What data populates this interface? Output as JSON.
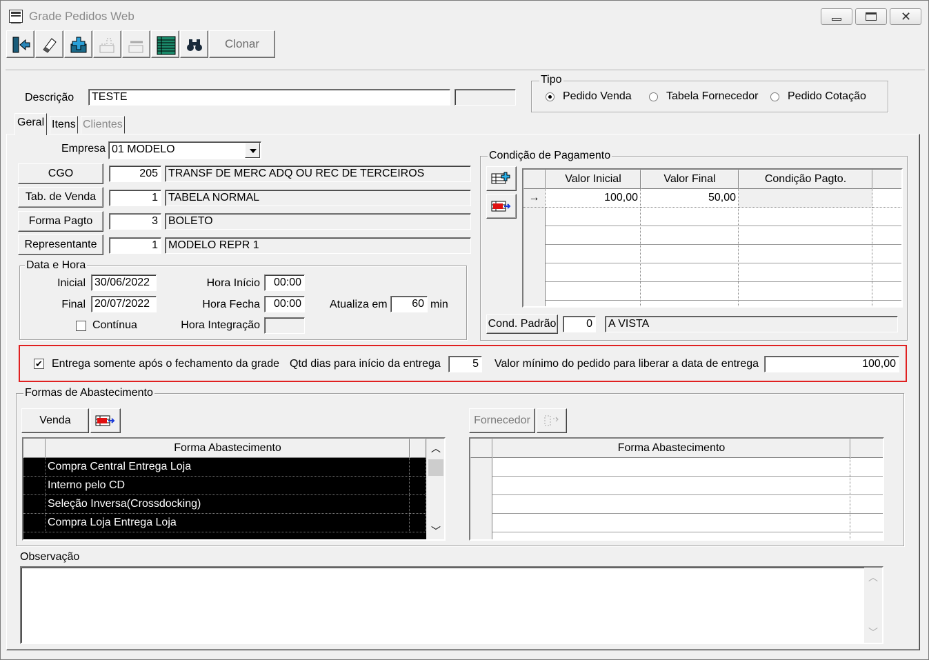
{
  "window": {
    "title": "Grade Pedidos Web",
    "controls": [
      "minimize-icon",
      "maximize-icon",
      "close-icon"
    ]
  },
  "toolbar": {
    "icons": [
      "exit-icon",
      "eraser-icon",
      "add-record-icon",
      "copy-disabled-icon",
      "remove-disabled-icon",
      "grid-sheet-icon",
      "binoculars-icon"
    ],
    "clonar_label": "Clonar"
  },
  "header": {
    "descricao_label": "Descrição",
    "descricao_value": "TESTE",
    "extra_value": ""
  },
  "tipo": {
    "title": "Tipo",
    "options": [
      {
        "label": "Pedido Venda",
        "selected": true
      },
      {
        "label": "Tabela Fornecedor",
        "selected": false
      },
      {
        "label": "Pedido Cotação",
        "selected": false
      }
    ]
  },
  "tabs": [
    {
      "label": "Geral",
      "active": true,
      "enabled": true
    },
    {
      "label": "Itens",
      "active": false,
      "enabled": true
    },
    {
      "label": "Clientes",
      "active": false,
      "enabled": false
    }
  ],
  "geral": {
    "empresa_label": "Empresa",
    "empresa_value": "01 MODELO",
    "cgo": {
      "button": "CGO",
      "code": "205",
      "desc": "TRANSF DE MERC ADQ OU REC DE TERCEIROS"
    },
    "tab_venda": {
      "button": "Tab. de Venda",
      "code": "1",
      "desc": "TABELA NORMAL"
    },
    "forma_pagto": {
      "button": "Forma Pagto",
      "code": "3",
      "desc": "BOLETO"
    },
    "representante": {
      "button": "Representante",
      "code": "1",
      "desc": "MODELO REPR 1"
    }
  },
  "data_hora": {
    "title": "Data e Hora",
    "inicial_label": "Inicial",
    "inicial_value": "30/06/2022",
    "final_label": "Final",
    "final_value": "20/07/2022",
    "continua_label": "Contínua",
    "continua_checked": false,
    "hora_inicio_label": "Hora Início",
    "hora_inicio_value": "00:00",
    "hora_fecha_label": "Hora Fecha",
    "hora_fecha_value": "00:00",
    "hora_integracao_label": "Hora Integração",
    "hora_integracao_value": "",
    "atualiza_label": "Atualiza em",
    "atualiza_value": "60",
    "min_label": "min"
  },
  "condicao_pagamento": {
    "title": "Condição de Pagamento",
    "columns": [
      "Valor Inicial",
      "Valor Final",
      "Condição Pagto."
    ],
    "rows": [
      {
        "valor_inicial": "100,00",
        "valor_final": "50,00",
        "condicao": "",
        "current": true
      }
    ],
    "cond_padrao_button": "Cond. Padrão",
    "cond_padrao_code": "0",
    "cond_padrao_desc": "A VISTA"
  },
  "entrega": {
    "checkbox_label": "Entrega somente após o fechamento da grade",
    "checked": true,
    "qtd_dias_label": "Qtd dias para início da entrega",
    "qtd_dias_value": "5",
    "valor_minimo_label": "Valor mínimo do pedido para liberar a data de entrega",
    "valor_minimo_value": "100,00",
    "highlight_color": "#e02020"
  },
  "formas_abastecimento": {
    "title": "Formas de Abastecimento",
    "venda_button": "Venda",
    "fornecedor_button": "Fornecedor",
    "left_column": "Forma Abastecimento",
    "left_rows": [
      "Compra Central Entrega Loja",
      "Interno pelo CD",
      "Seleção Inversa(Crossdocking)",
      "Compra Loja Entrega Loja"
    ],
    "right_column": "Forma Abastecimento"
  },
  "observacao": {
    "label": "Observação",
    "value": ""
  }
}
